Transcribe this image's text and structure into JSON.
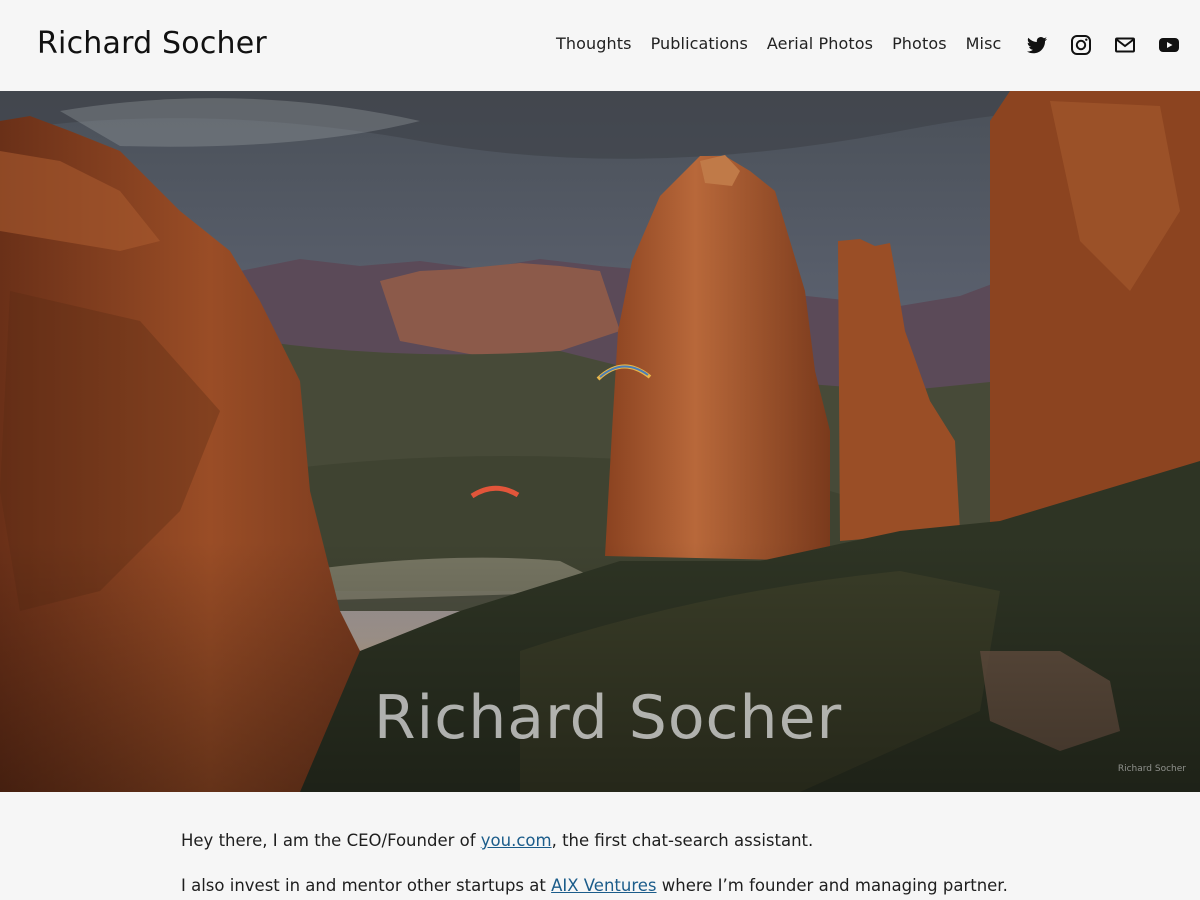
{
  "header": {
    "site_title": "Richard Socher",
    "nav": [
      "Thoughts",
      "Publications",
      "Aerial Photos",
      "Photos",
      "Misc"
    ],
    "social": [
      "twitter-icon",
      "instagram-icon",
      "email-icon",
      "youtube-icon"
    ]
  },
  "hero": {
    "title": "Richard Socher",
    "watermark": "Richard Socher"
  },
  "intro": {
    "p1_before": "Hey there,  I am the CEO/Founder of ",
    "p1_link": "you.com",
    "p1_after": ", the first chat-search assistant.",
    "p2_before": "I also invest in and mentor other startups at ",
    "p2_link": "AIX Ventures",
    "p2_after": " where I’m founder and managing partner."
  },
  "colors": {
    "link": "#1b5c8a",
    "background": "#f6f6f6",
    "text": "#1e1e1e"
  }
}
